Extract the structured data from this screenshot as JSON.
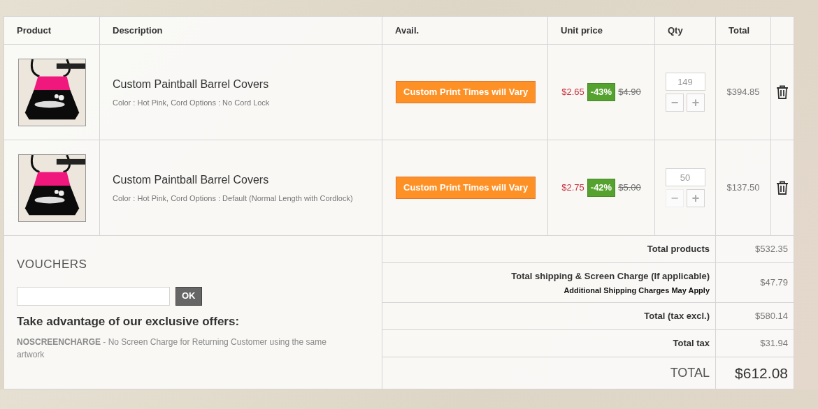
{
  "columns": [
    "Product",
    "Description",
    "Avail.",
    "Unit price",
    "Qty",
    "Total"
  ],
  "items": [
    {
      "name": "Custom Paintball Barrel Covers",
      "attributes": "Color : Hot Pink, Cord Options : No Cord Lock",
      "availability": "Custom Print Times will Vary",
      "price": "$2.65",
      "discount": "-43%",
      "old_price": "$4.90",
      "qty": "149",
      "minus": "−",
      "plus": "+",
      "minus_disabled": false,
      "total": "$394.85"
    },
    {
      "name": "Custom Paintball Barrel Covers",
      "attributes": "Color : Hot Pink, Cord Options : Default (Normal Length with Cordlock)",
      "availability": "Custom Print Times will Vary",
      "price": "$2.75",
      "discount": "-42%",
      "old_price": "$5.00",
      "qty": "50",
      "minus": "−",
      "plus": "+",
      "minus_disabled": true,
      "total": "$137.50"
    }
  ],
  "vouchers": {
    "title": "VOUCHERS",
    "button": "OK",
    "offers_title": "Take advantage of our exclusive offers:",
    "offers": [
      "**NOSCREENCHARGE** - No Screen Charge for Returning Customer using the same artwork"
    ]
  },
  "summary": [
    {
      "kind": "line",
      "label": "Total products",
      "value": "$532.35"
    },
    {
      "kind": "line",
      "label": "Total shipping & Screen Charge (If applicable)",
      "note": "Additional Shipping Charges May Apply",
      "value": "$47.79"
    },
    {
      "kind": "line",
      "label": "Total (tax excl.)",
      "value": "$580.14"
    },
    {
      "kind": "line",
      "label": "Total tax",
      "value": "$31.94"
    },
    {
      "kind": "grand",
      "label": "TOTAL",
      "value": "$612.08"
    }
  ]
}
